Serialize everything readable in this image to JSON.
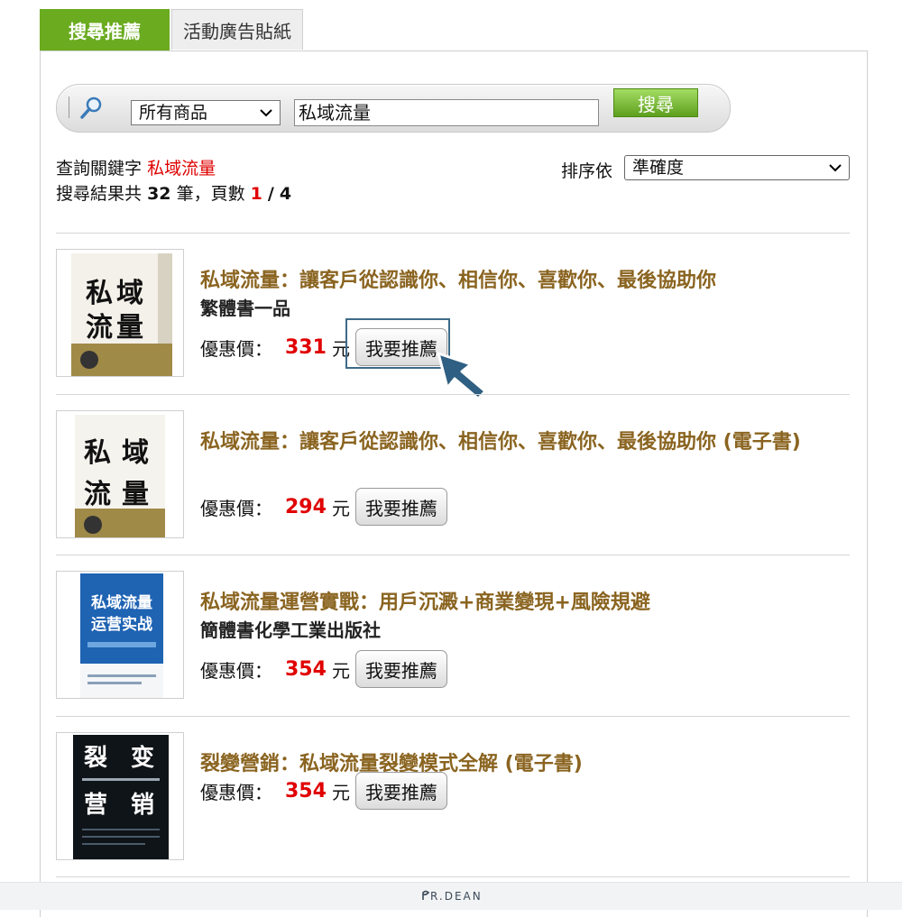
{
  "tabs": {
    "active": "搜尋推薦",
    "inactive": "活動廣告貼紙"
  },
  "search": {
    "category": "所有商品",
    "keyword": "私域流量",
    "button": "搜尋"
  },
  "query": {
    "prefix": "查詢關鍵字",
    "keyword": "私域流量",
    "results_prefix": "搜尋結果共",
    "count": "32",
    "results_mid": "筆，頁數",
    "page": "1",
    "page_sep": "/",
    "total_pages": "4"
  },
  "sort": {
    "label": "排序依",
    "value": "準確度"
  },
  "products": [
    {
      "title": "私域流量：讓客戶從認識你、相信你、喜歡你、最後協助你",
      "publisher": "繁體書一品",
      "price_label": "優惠價：",
      "price": "331",
      "currency": "元",
      "button": "我要推薦",
      "cover_text": [
        "私",
        "域",
        "流",
        "量"
      ]
    },
    {
      "title": "私域流量：讓客戶從認識你、相信你、喜歡你、最後協助你 (電子書)",
      "price_label": "優惠價：",
      "price": "294",
      "currency": "元",
      "button": "我要推薦",
      "cover_text": [
        "私",
        "域",
        "流",
        "量"
      ]
    },
    {
      "title": "私域流量運營實戰：用戶沉澱+商業變現+風險規避",
      "publisher": "簡體書化學工業出版社",
      "price_label": "優惠價：",
      "price": "354",
      "currency": "元",
      "button": "我要推薦",
      "cover_text": [
        "私域流量",
        "运营实战"
      ]
    },
    {
      "title": "裂變營銷：私域流量裂變模式全解 (電子書)",
      "price_label": "優惠價：",
      "price": "354",
      "currency": "元",
      "button": "我要推薦",
      "cover_text": [
        "裂",
        "变",
        "营",
        "销"
      ]
    }
  ],
  "footer": {
    "logo": "R.DEAN"
  },
  "colors": {
    "tab_green": "#6aab1f",
    "title_brown": "#8a6420",
    "price_red": "#e00000"
  }
}
